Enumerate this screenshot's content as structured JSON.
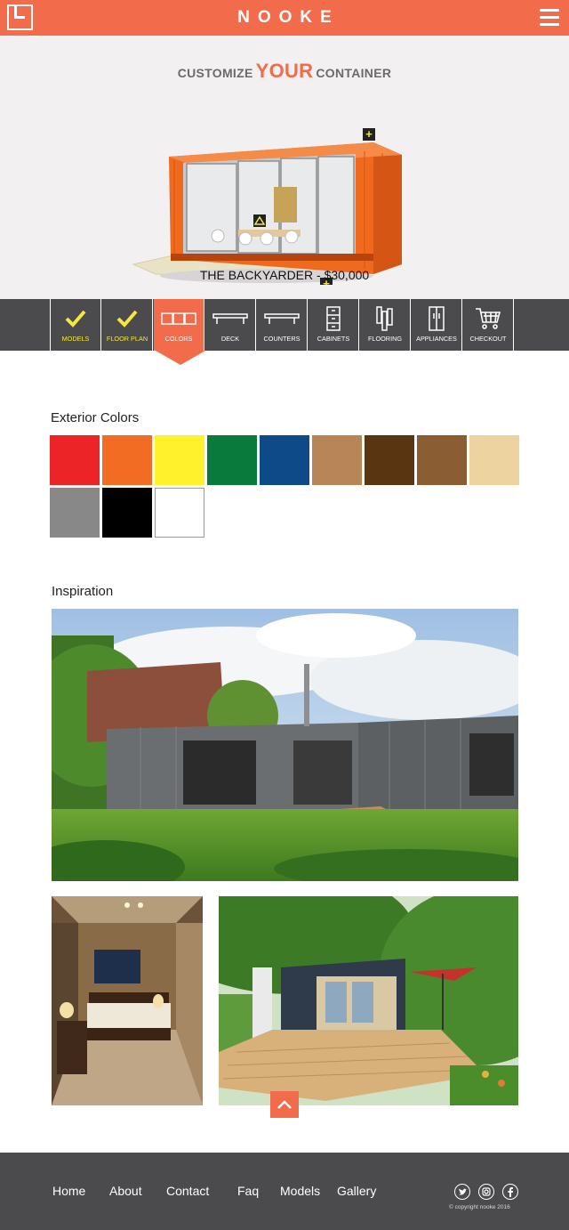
{
  "header": {
    "brand": "NOOKE"
  },
  "hero": {
    "title_pre": "CUSTOMIZE",
    "title_accent": "YOUR",
    "title_post": "CONTAINER",
    "model_label": "THE BACKYARDER - $30,000"
  },
  "steps": [
    {
      "label": "MODELS",
      "state": "done",
      "icon": "check-icon"
    },
    {
      "label": "FLOOR PLAN",
      "state": "done",
      "icon": "check-icon"
    },
    {
      "label": "COLORS",
      "state": "active",
      "icon": "color-swatches-icon"
    },
    {
      "label": "DECK",
      "state": "pending",
      "icon": "deck-icon"
    },
    {
      "label": "COUNTERS",
      "state": "pending",
      "icon": "counter-icon"
    },
    {
      "label": "CABINETS",
      "state": "pending",
      "icon": "cabinet-icon"
    },
    {
      "label": "FLOORING",
      "state": "pending",
      "icon": "flooring-icon"
    },
    {
      "label": "APPLIANCES",
      "state": "pending",
      "icon": "appliance-icon"
    },
    {
      "label": "CHECKOUT",
      "state": "pending",
      "icon": "cart-icon"
    }
  ],
  "colors": {
    "heading": "Exterior Colors",
    "swatches": [
      "#ec2327",
      "#f26c23",
      "#fff22c",
      "#0a7a3c",
      "#0d4a87",
      "#b78558",
      "#5a3512",
      "#8a5d32",
      "#ecd3a0",
      "#888888",
      "#000000",
      "#ffffff"
    ]
  },
  "inspiration": {
    "heading": "Inspiration"
  },
  "footer": {
    "nav": [
      "Home",
      "About",
      "Contact",
      "Faq",
      "Models",
      "Gallery"
    ],
    "social": [
      "twitter-icon",
      "instagram-icon",
      "facebook-icon"
    ],
    "copyright": "© copyright nooke 2016"
  },
  "theme": {
    "accent": "#f26b4a",
    "bar": "#4b4a4c",
    "check": "#f5e83a"
  }
}
